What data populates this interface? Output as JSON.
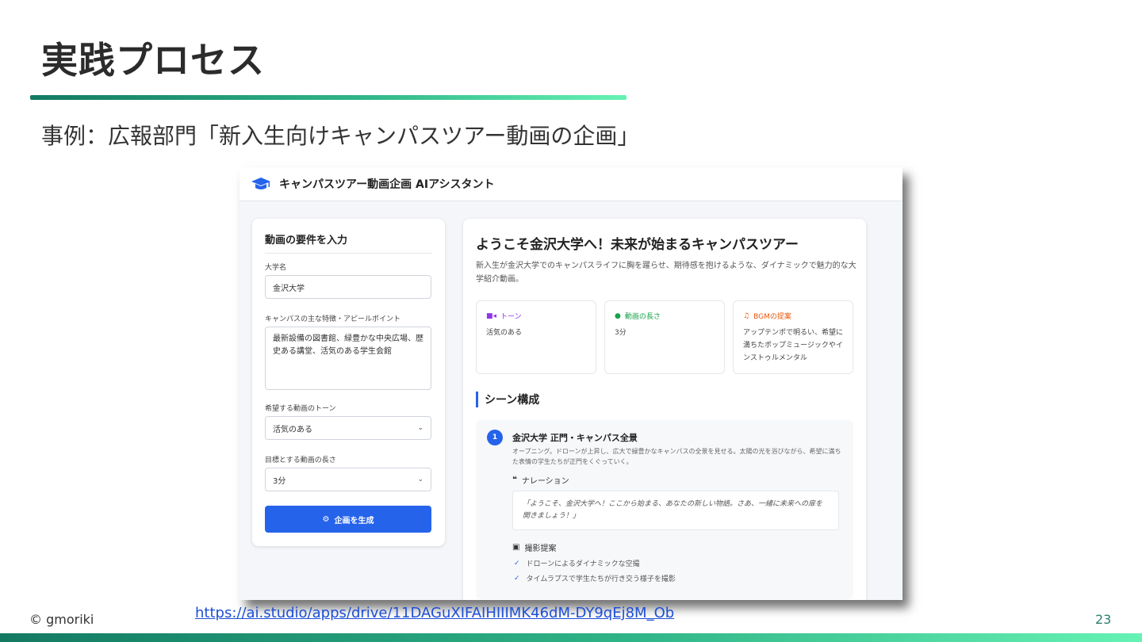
{
  "slide": {
    "title": "実践プロセス",
    "subtitle": "事例：広報部門「新入生向けキャンパスツアー動画の企画」",
    "copyright": "© gmoriki",
    "link": "https://ai.studio/apps/drive/11DAGuXIFAIHIIIMK46dM-DY9qEj8M_Ob",
    "page_number": "23",
    "accent_colors": [
      "#137a62",
      "#2fb487",
      "#66f2b4"
    ]
  },
  "app": {
    "title": "キャンパスツアー動画企画 AIアシスタント",
    "logo_icon": "graduation-cap-icon",
    "accent": "#2563eb",
    "form": {
      "heading": "動画の要件を入力",
      "university_label": "大学名",
      "university_value": "金沢大学",
      "features_label": "キャンパスの主な特徴・アピールポイント",
      "features_value": "最新設備の図書館、緑豊かな中央広場、歴史ある講堂、活気のある学生会館",
      "tone_label": "希望する動画のトーン",
      "tone_value": "活気のある",
      "length_label": "目標とする動画の長さ",
      "length_value": "3分",
      "generate_label": "企画を生成"
    },
    "result": {
      "title": "ようこそ金沢大学へ！未来が始まるキャンパスツアー",
      "description": "新入生が金沢大学でのキャンパスライフに胸を躍らせ、期待感を抱けるような、ダイナミックで魅力的な大学紹介動画。",
      "info": [
        {
          "icon": "video-icon",
          "label": "トーン",
          "value": "活気のある",
          "color": "#9333ea"
        },
        {
          "icon": "clock-icon",
          "label": "動画の長さ",
          "value": "3分",
          "color": "#16a34a"
        },
        {
          "icon": "music-icon",
          "label": "BGMの提案",
          "value": "アップテンポで明るい、希望に満ちたポップミュージックやインストゥルメンタル",
          "color": "#ea580c"
        }
      ],
      "scenes_heading": "シーン構成",
      "scene": {
        "number": "1",
        "title": "金沢大学 正門・キャンパス全景",
        "description": "オープニング。ドローンが上昇し、広大で緑豊かなキャンパスの全景を見せる。太陽の光を浴びながら、希望に満ちた表情の学生たちが正門をくぐっていく。",
        "narration_label": "ナレーション",
        "narration": "「ようこそ、金沢大学へ！ここから始まる、あなたの新しい物語。さあ、一緒に未来への扉を開きましょう！」",
        "shooting_label": "撮影提案",
        "shooting_items": [
          "ドローンによるダイナミックな空撮",
          "タイムラプスで学生たちが行き交う様子を撮影"
        ]
      }
    }
  }
}
